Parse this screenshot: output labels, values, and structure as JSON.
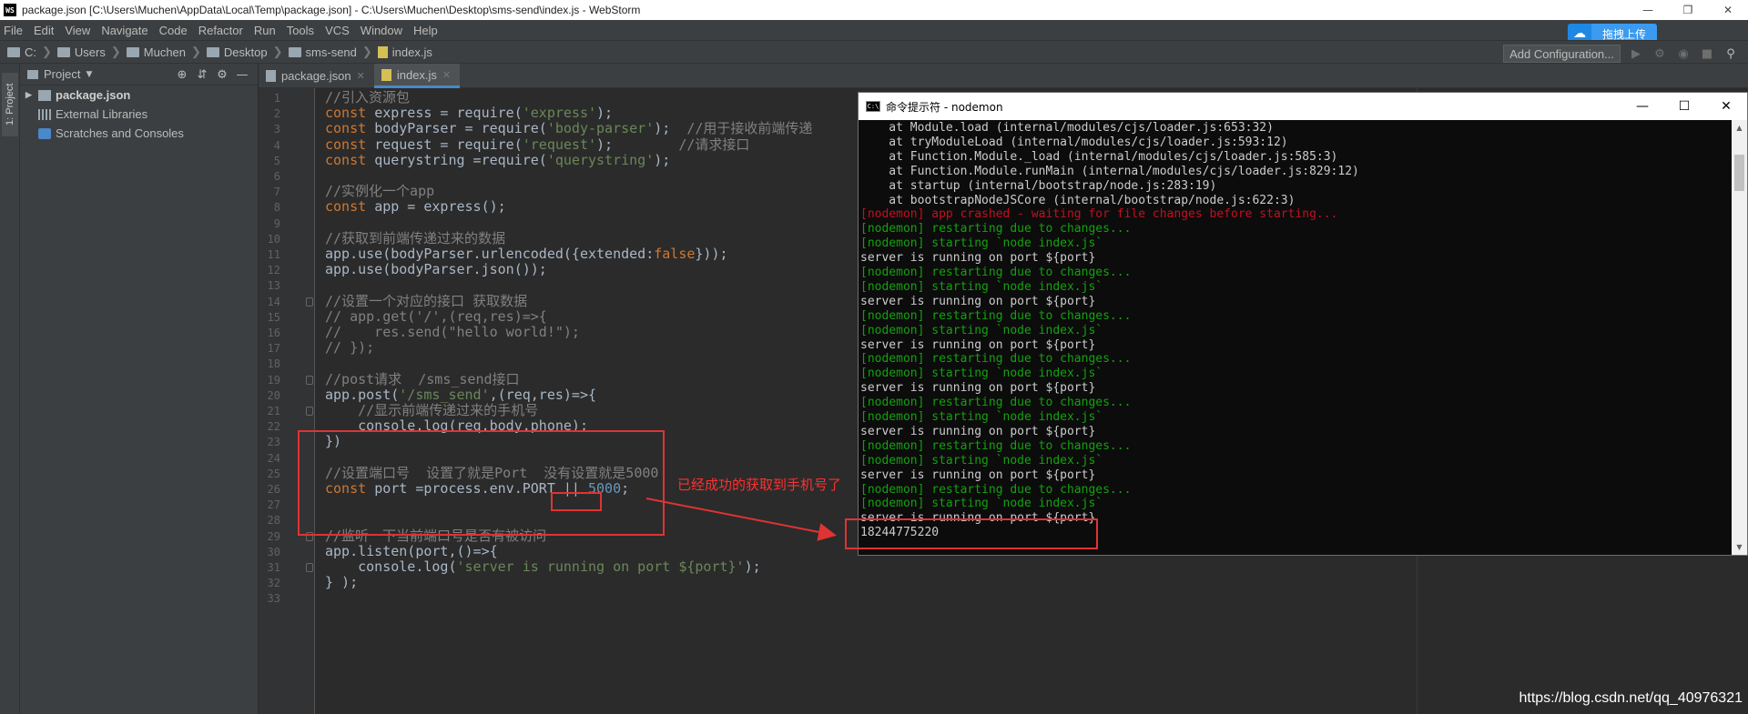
{
  "window": {
    "title": "package.json [C:\\Users\\Muchen\\AppData\\Local\\Temp\\package.json] - C:\\Users\\Muchen\\Desktop\\sms-send\\index.js - WebStorm",
    "logo": "WS"
  },
  "menu": [
    "File",
    "Edit",
    "View",
    "Navigate",
    "Code",
    "Refactor",
    "Run",
    "Tools",
    "VCS",
    "Window",
    "Help"
  ],
  "upload_label": "拖拽上传",
  "breadcrumb": [
    "C:",
    "Users",
    "Muchen",
    "Desktop",
    "sms-send",
    "index.js"
  ],
  "add_config": "Add Configuration...",
  "side_tab": "1: Project",
  "project": {
    "title": "Project",
    "items": [
      "package.json",
      "External Libraries",
      "Scratches and Consoles"
    ]
  },
  "tabs": [
    "package.json",
    "index.js"
  ],
  "annotation": "已经成功的获取到手机号了",
  "terminal": {
    "title": "命令提示符 - nodemon",
    "lines": [
      {
        "text": "    at Module.load (internal/modules/cjs/loader.js:653:32)",
        "color": "white"
      },
      {
        "text": "    at tryModuleLoad (internal/modules/cjs/loader.js:593:12)",
        "color": "white"
      },
      {
        "text": "    at Function.Module._load (internal/modules/cjs/loader.js:585:3)",
        "color": "white"
      },
      {
        "text": "    at Function.Module.runMain (internal/modules/cjs/loader.js:829:12)",
        "color": "white"
      },
      {
        "text": "    at startup (internal/bootstrap/node.js:283:19)",
        "color": "white"
      },
      {
        "text": "    at bootstrapNodeJSCore (internal/bootstrap/node.js:622:3)",
        "color": "white"
      },
      {
        "text": "[nodemon] app crashed - waiting for file changes before starting...",
        "color": "red"
      },
      {
        "text": "[nodemon] restarting due to changes...",
        "color": "green"
      },
      {
        "text": "[nodemon] starting `node index.js`",
        "color": "green"
      },
      {
        "text": "server is running on port ${port}",
        "color": "white"
      },
      {
        "text": "[nodemon] restarting due to changes...",
        "color": "green"
      },
      {
        "text": "[nodemon] starting `node index.js`",
        "color": "green"
      },
      {
        "text": "server is running on port ${port}",
        "color": "white"
      },
      {
        "text": "[nodemon] restarting due to changes...",
        "color": "green"
      },
      {
        "text": "[nodemon] starting `node index.js`",
        "color": "green"
      },
      {
        "text": "server is running on port ${port}",
        "color": "white"
      },
      {
        "text": "[nodemon] restarting due to changes...",
        "color": "green"
      },
      {
        "text": "[nodemon] starting `node index.js`",
        "color": "green"
      },
      {
        "text": "server is running on port ${port}",
        "color": "white"
      },
      {
        "text": "[nodemon] restarting due to changes...",
        "color": "green"
      },
      {
        "text": "[nodemon] starting `node index.js`",
        "color": "green"
      },
      {
        "text": "server is running on port ${port}",
        "color": "white"
      },
      {
        "text": "[nodemon] restarting due to changes...",
        "color": "green"
      },
      {
        "text": "[nodemon] starting `node index.js`",
        "color": "green"
      },
      {
        "text": "server is running on port ${port}",
        "color": "white"
      },
      {
        "text": "[nodemon] restarting due to changes...",
        "color": "green"
      },
      {
        "text": "[nodemon] starting `node index.js`",
        "color": "green"
      },
      {
        "text": "server is running on port ${port}",
        "color": "white"
      },
      {
        "text": "18244775220",
        "color": "white"
      }
    ]
  },
  "code_lines": [
    [
      [
        "cm",
        "//引入资源包"
      ]
    ],
    [
      [
        "kw",
        "const "
      ],
      [
        "",
        "express = require("
      ],
      [
        "str",
        "'express'"
      ],
      [
        "",
        ");"
      ]
    ],
    [
      [
        "kw",
        "const "
      ],
      [
        "",
        "bodyParser = require("
      ],
      [
        "str",
        "'body-parser'"
      ],
      [
        "",
        ");  "
      ],
      [
        "cm",
        "//用于接收前端传递"
      ]
    ],
    [
      [
        "kw",
        "const "
      ],
      [
        "",
        "request = require("
      ],
      [
        "str",
        "'request'"
      ],
      [
        "",
        ");        "
      ],
      [
        "cm",
        "//请求接口"
      ]
    ],
    [
      [
        "kw",
        "const "
      ],
      [
        "",
        "querystring =require("
      ],
      [
        "str",
        "'querystring'"
      ],
      [
        "",
        ");"
      ]
    ],
    [],
    [
      [
        "cm",
        "//实例化一个app"
      ]
    ],
    [
      [
        "kw",
        "const "
      ],
      [
        "",
        "app = express();"
      ]
    ],
    [],
    [
      [
        "cm",
        "//获取到前端传递过来的数据"
      ]
    ],
    [
      [
        "",
        "app.use(bodyParser.urlencoded({extended:"
      ],
      [
        "kw",
        "false"
      ],
      [
        "",
        "}));"
      ]
    ],
    [
      [
        "",
        "app.use(bodyParser.json());"
      ]
    ],
    [],
    [
      [
        "cm",
        "//设置一个对应的接口 获取数据"
      ]
    ],
    [
      [
        "cm",
        "// app.get('/',(req,res)=>{"
      ]
    ],
    [
      [
        "cm",
        "//    res.send(\"hello world!\");"
      ]
    ],
    [
      [
        "cm",
        "// });"
      ]
    ],
    [],
    [
      [
        "cm",
        "//post请求  /sms_send接口"
      ]
    ],
    [
      [
        "",
        "app.post("
      ],
      [
        "str",
        "'/sms_send'"
      ],
      [
        "",
        ",(req,res)=>{"
      ]
    ],
    [
      [
        "",
        "    "
      ],
      [
        "cm",
        "//显示前端传递过来的手机号"
      ]
    ],
    [
      [
        "",
        "    console.log(req.body.phone);"
      ]
    ],
    [
      [
        "",
        "})"
      ]
    ],
    [],
    [
      [
        "cm",
        "//设置端口号  设置了就是Port  没有设置就是5000"
      ]
    ],
    [
      [
        "kw",
        "const "
      ],
      [
        "",
        "port =process.env.PORT || "
      ],
      [
        "num",
        "5000"
      ],
      [
        "",
        ";"
      ]
    ],
    [],
    [],
    [
      [
        "cm",
        "//监听一下当前端口号是否有被访问"
      ]
    ],
    [
      [
        "",
        "app.listen(port,()=>{"
      ]
    ],
    [
      [
        "",
        "    console.log("
      ],
      [
        "str",
        "'server is running on port ${port}'"
      ],
      [
        "",
        ");"
      ]
    ],
    [
      [
        "",
        "} );"
      ]
    ],
    []
  ],
  "watermark": "https://blog.csdn.net/qq_40976321"
}
